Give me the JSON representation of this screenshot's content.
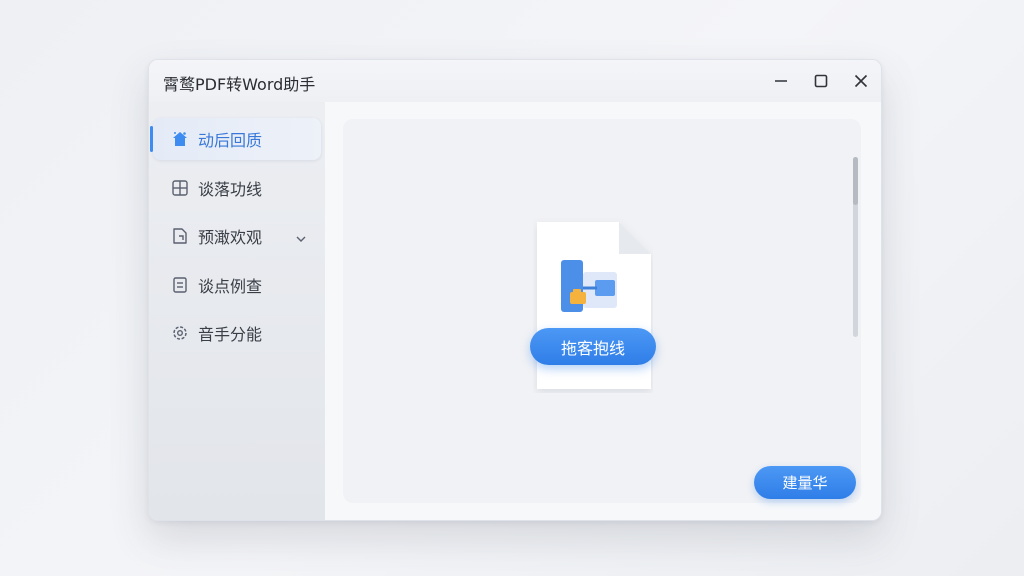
{
  "window": {
    "title": "霄鹜PDF转Word助手",
    "controls": [
      "minimize-icon",
      "maximize-icon",
      "close-icon"
    ]
  },
  "sidebar": {
    "items": [
      {
        "label": "动后回质",
        "icon": "home-icon",
        "active": true
      },
      {
        "label": "谈落功线",
        "icon": "grid-icon",
        "active": false
      },
      {
        "label": "预澉欢观",
        "icon": "document-fold-icon",
        "active": false,
        "expandable": true
      },
      {
        "label": "谈点例查",
        "icon": "list-doc-icon",
        "active": false
      },
      {
        "label": "音手分能",
        "icon": "gear-icon",
        "active": false
      }
    ]
  },
  "main": {
    "drag_button_label": "拖客抱线",
    "confirm_button_label": "建量华"
  },
  "colors": {
    "accent": "#3e8cf0",
    "active_text": "#3a78d8",
    "window_bg": "#f3f4f7"
  }
}
